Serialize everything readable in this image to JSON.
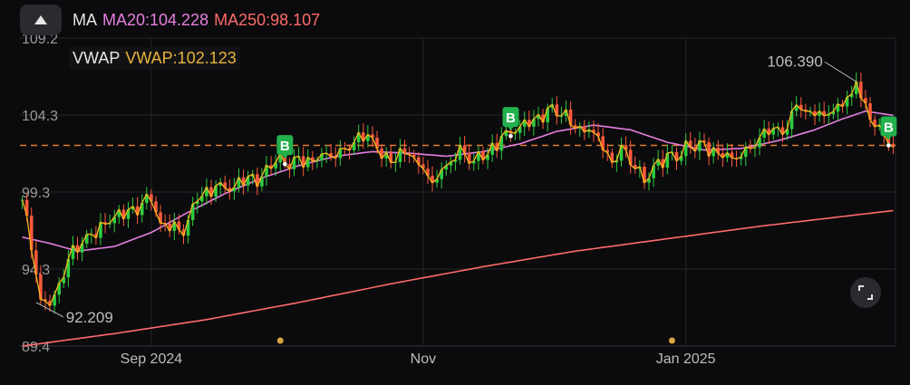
{
  "legend": {
    "ma_label": "MA",
    "ma20_text": "MA20:104.228",
    "ma250_text": "MA250:98.107",
    "vwap_label": "VWAP",
    "vwap_text": "VWAP:102.123"
  },
  "controls": {
    "collapse_icon": "triangle-up-icon",
    "expand_icon": "fullscreen-icon"
  },
  "colors": {
    "up": "#2ecc40",
    "down": "#ff5a3a",
    "price_line": "#f5b81c",
    "ma20": "#e57fe0",
    "ma250": "#ff6a6a",
    "ref_line": "#e07b2e",
    "buy_marker": "#22b14c",
    "event_dot": "#d9a441"
  },
  "chart_data": {
    "type": "candlestick",
    "y_ticks": [
      "109.2",
      "104.3",
      "99.3",
      "94.3",
      "89.4"
    ],
    "ylim": [
      89.4,
      109.2
    ],
    "x_ticks": [
      {
        "label": "Sep 2024",
        "index": 28
      },
      {
        "label": "Nov",
        "index": 87
      },
      {
        "label": "Jan 2025",
        "index": 144
      }
    ],
    "x_count": 190,
    "grid": true,
    "reference_line": 102.3,
    "annotations": [
      {
        "text": "106.390",
        "index": 181,
        "value": 106.39,
        "type": "high"
      },
      {
        "text": "92.209",
        "index": 3,
        "value": 92.209,
        "type": "low"
      }
    ],
    "buy_markers": [
      {
        "text": "B",
        "index": 57,
        "value": 101.1
      },
      {
        "text": "B",
        "index": 106,
        "value": 102.9
      },
      {
        "text": "B",
        "index": 188,
        "value": 102.3
      }
    ],
    "event_dots": [
      56,
      141
    ],
    "close_anchors": [
      [
        0,
        98.8
      ],
      [
        3,
        94.0
      ],
      [
        4,
        92.4
      ],
      [
        7,
        92.7
      ],
      [
        10,
        95.0
      ],
      [
        15,
        96.6
      ],
      [
        20,
        97.7
      ],
      [
        26,
        98.6
      ],
      [
        28,
        98.7
      ],
      [
        30,
        97.3
      ],
      [
        33,
        97.4
      ],
      [
        35,
        96.5
      ],
      [
        38,
        98.7
      ],
      [
        42,
        99.7
      ],
      [
        46,
        99.6
      ],
      [
        49,
        100.3
      ],
      [
        52,
        100.3
      ],
      [
        55,
        101.2
      ],
      [
        57,
        101.1
      ],
      [
        60,
        101.6
      ],
      [
        63,
        101.3
      ],
      [
        66,
        101.8
      ],
      [
        69,
        102.1
      ],
      [
        72,
        102.5
      ],
      [
        75,
        103.0
      ],
      [
        77,
        102.1
      ],
      [
        80,
        101.2
      ],
      [
        84,
        101.7
      ],
      [
        87,
        100.8
      ],
      [
        89,
        99.9
      ],
      [
        92,
        101.0
      ],
      [
        95,
        102.3
      ],
      [
        98,
        101.3
      ],
      [
        101,
        101.7
      ],
      [
        104,
        102.9
      ],
      [
        106,
        103.1
      ],
      [
        108,
        103.5
      ],
      [
        111,
        104.0
      ],
      [
        114,
        104.7
      ],
      [
        117,
        104.2
      ],
      [
        120,
        103.4
      ],
      [
        123,
        103.3
      ],
      [
        126,
        102.0
      ],
      [
        128,
        101.2
      ],
      [
        130,
        102.3
      ],
      [
        133,
        100.8
      ],
      [
        135,
        99.9
      ],
      [
        137,
        101.0
      ],
      [
        140,
        101.8
      ],
      [
        142,
        101.3
      ],
      [
        145,
        102.2
      ],
      [
        148,
        102.5
      ],
      [
        151,
        101.8
      ],
      [
        154,
        101.5
      ],
      [
        157,
        102.2
      ],
      [
        160,
        102.8
      ],
      [
        163,
        103.4
      ],
      [
        165,
        103.0
      ],
      [
        168,
        104.9
      ],
      [
        170,
        104.5
      ],
      [
        172,
        104.2
      ],
      [
        175,
        104.3
      ],
      [
        178,
        104.8
      ],
      [
        180,
        105.6
      ],
      [
        181,
        106.39
      ],
      [
        183,
        105.0
      ],
      [
        185,
        103.5
      ],
      [
        187,
        103.0
      ],
      [
        189,
        102.2
      ]
    ],
    "series": [
      {
        "name": "MA20",
        "points": [
          [
            0,
            96.4
          ],
          [
            6,
            96.0
          ],
          [
            12,
            95.5
          ],
          [
            20,
            95.8
          ],
          [
            28,
            96.7
          ],
          [
            36,
            98.0
          ],
          [
            44,
            99.2
          ],
          [
            52,
            100.2
          ],
          [
            60,
            101.0
          ],
          [
            68,
            101.6
          ],
          [
            76,
            101.9
          ],
          [
            84,
            101.8
          ],
          [
            92,
            101.6
          ],
          [
            100,
            101.9
          ],
          [
            108,
            102.4
          ],
          [
            116,
            103.2
          ],
          [
            124,
            103.6
          ],
          [
            132,
            103.3
          ],
          [
            140,
            102.5
          ],
          [
            148,
            102.0
          ],
          [
            156,
            102.1
          ],
          [
            164,
            102.6
          ],
          [
            172,
            103.3
          ],
          [
            178,
            104.0
          ],
          [
            183,
            104.5
          ],
          [
            189,
            104.228
          ]
        ]
      },
      {
        "name": "MA250",
        "points": [
          [
            0,
            89.4
          ],
          [
            20,
            90.2
          ],
          [
            40,
            91.1
          ],
          [
            60,
            92.2
          ],
          [
            80,
            93.4
          ],
          [
            100,
            94.5
          ],
          [
            120,
            95.5
          ],
          [
            140,
            96.3
          ],
          [
            160,
            97.1
          ],
          [
            180,
            97.8
          ],
          [
            189,
            98.107
          ]
        ]
      }
    ]
  }
}
